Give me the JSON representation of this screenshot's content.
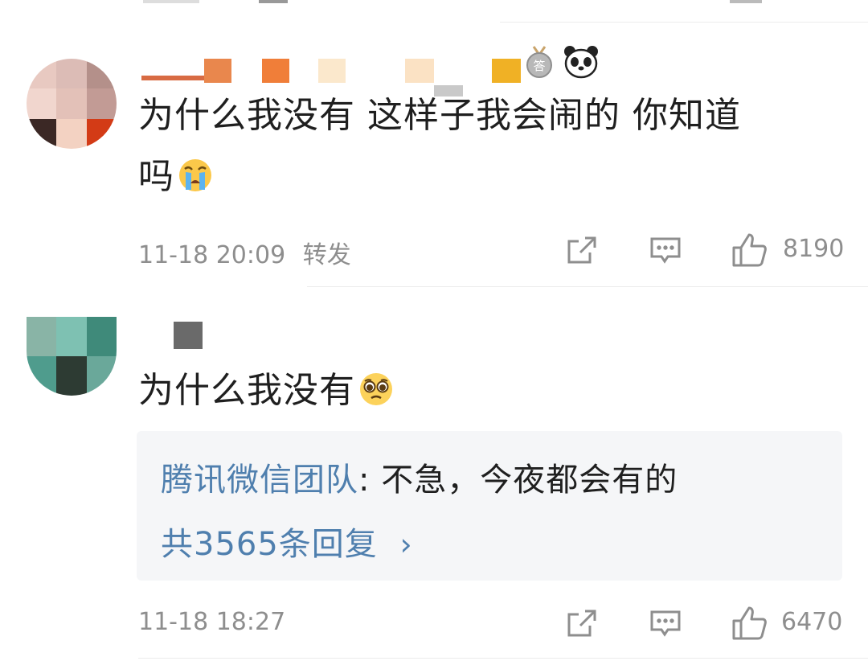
{
  "comments": [
    {
      "text": "为什么我没有 这样子我会闹的 你知道吗",
      "text_line1": "为什么我没有 这样子我会闹的 你知道",
      "text_line2": "吗",
      "emoji": "loudly-crying-face-emoji",
      "timestamp": "11-18 20:09",
      "repost_label": "转发",
      "badges": [
        "answerer-medal-icon",
        "panda-icon"
      ],
      "likes": "8190"
    },
    {
      "text": "为什么我没有",
      "emoji": "pleading-face-emoji",
      "timestamp": "11-18 18:27",
      "likes": "6470",
      "reply": {
        "author": "腾讯微信团队",
        "separator": ": ",
        "text": "不急，今夜都会有的",
        "more_label": "共3565条回复",
        "more_chevron": "›"
      }
    }
  ],
  "colors": {
    "link": "#4f7fae",
    "meta": "#8e8e8e",
    "reply_bg": "#f5f6f8"
  }
}
